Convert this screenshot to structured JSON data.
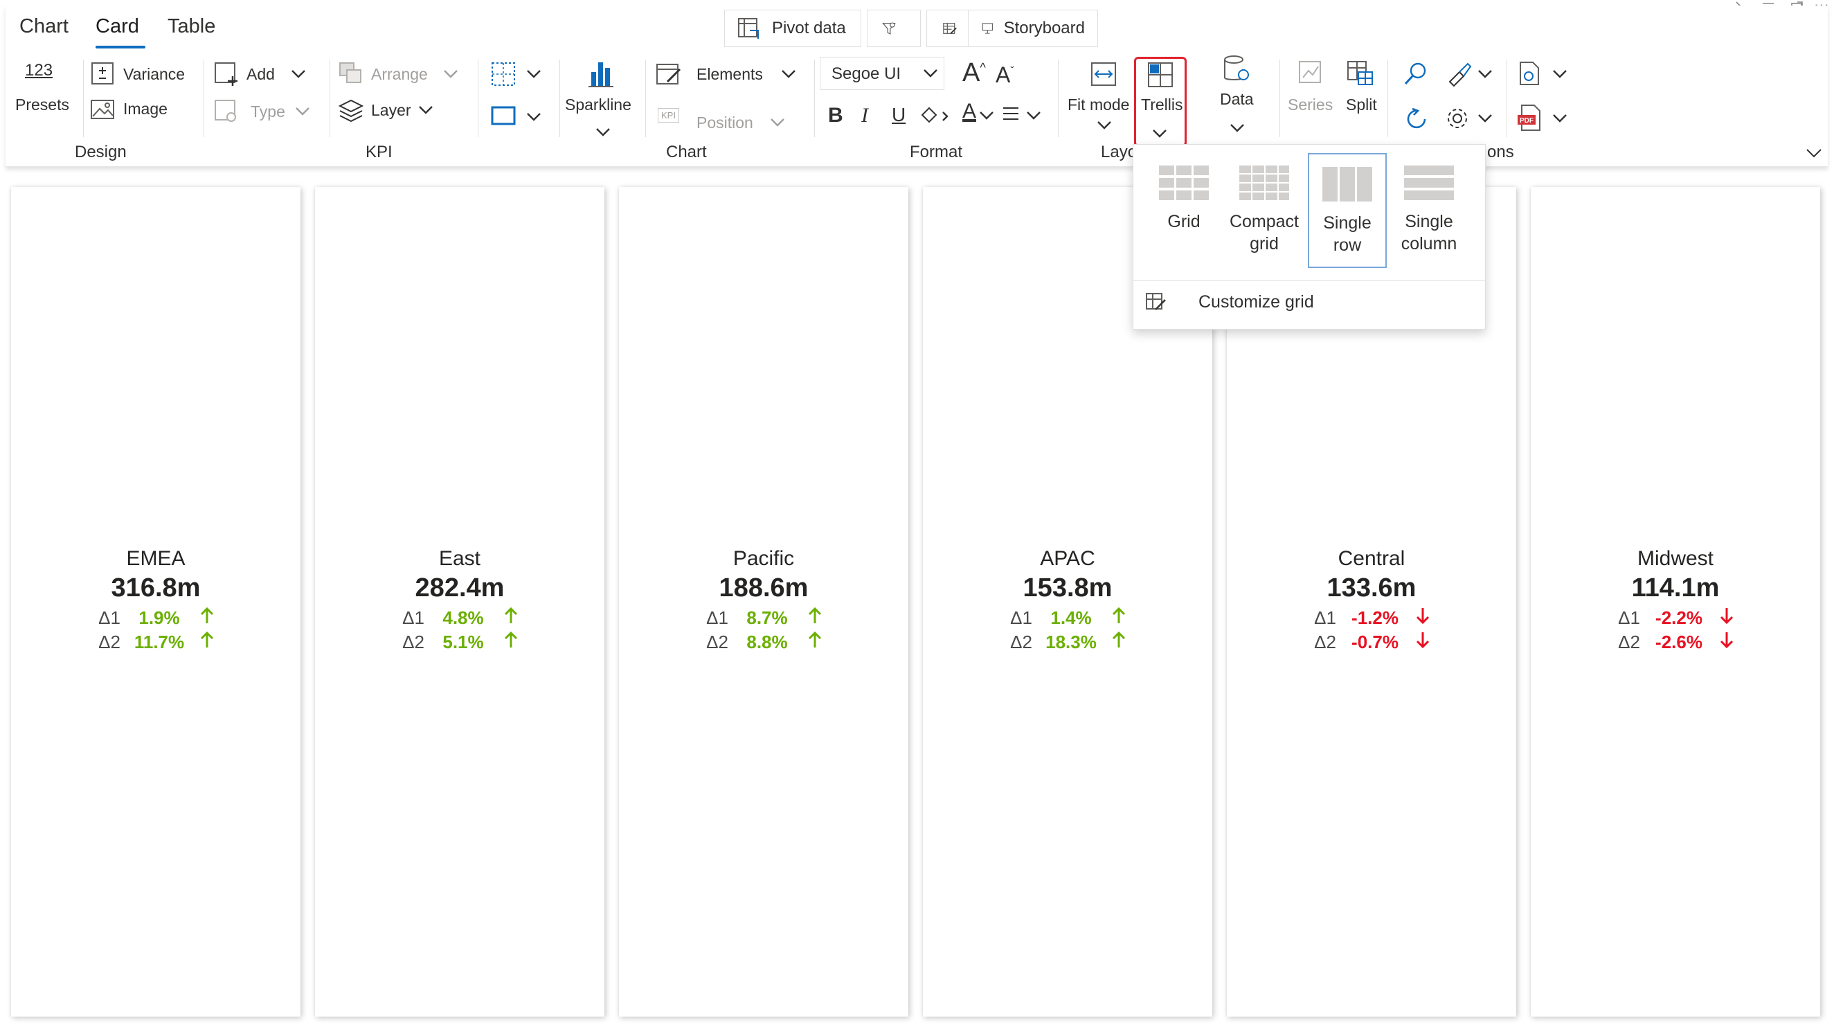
{
  "tabs": [
    {
      "label": "Chart",
      "active": false
    },
    {
      "label": "Card",
      "active": true
    },
    {
      "label": "Table",
      "active": false
    }
  ],
  "top_buttons": {
    "pivot_data": "Pivot data",
    "storyboard": "Storyboard"
  },
  "ribbon": {
    "design": {
      "presets_number": "123",
      "presets_label": "Presets",
      "variance": "Variance",
      "image": "Image",
      "group": "Design"
    },
    "kpi": {
      "add": "Add",
      "type": "Type",
      "arrange": "Arrange",
      "layer": "Layer",
      "group": "KPI"
    },
    "chart": {
      "sparkline": "Sparkline",
      "elements": "Elements",
      "position": "Position",
      "kpi_badge": "KPI",
      "group": "Chart"
    },
    "format": {
      "font": "Segoe UI",
      "bold": "B",
      "italic": "I",
      "underline": "U",
      "font_color_letter": "A",
      "group": "Format"
    },
    "layout": {
      "fit_mode": "Fit mode",
      "trellis": "Trellis",
      "group": "Layo"
    },
    "data": {
      "label": "Data"
    },
    "series": {
      "series": "Series",
      "split": "Split"
    },
    "options_group": "ons"
  },
  "trellis_menu": {
    "options": [
      {
        "label_line1": "Grid",
        "label_line2": "",
        "selected": false
      },
      {
        "label_line1": "Compact",
        "label_line2": "grid",
        "selected": false
      },
      {
        "label_line1": "Single",
        "label_line2": "row",
        "selected": true
      },
      {
        "label_line1": "Single",
        "label_line2": "column",
        "selected": false
      }
    ],
    "customize": "Customize grid"
  },
  "cards": [
    {
      "name": "EMEA",
      "value": "316.8m",
      "d1_label": "Δ1",
      "d1": "1.9%",
      "d1_dir": "up",
      "d2_label": "Δ2",
      "d2": "11.7%",
      "d2_dir": "up"
    },
    {
      "name": "East",
      "value": "282.4m",
      "d1_label": "Δ1",
      "d1": "4.8%",
      "d1_dir": "up",
      "d2_label": "Δ2",
      "d2": "5.1%",
      "d2_dir": "up"
    },
    {
      "name": "Pacific",
      "value": "188.6m",
      "d1_label": "Δ1",
      "d1": "8.7%",
      "d1_dir": "up",
      "d2_label": "Δ2",
      "d2": "8.8%",
      "d2_dir": "up"
    },
    {
      "name": "APAC",
      "value": "153.8m",
      "d1_label": "Δ1",
      "d1": "1.4%",
      "d1_dir": "up",
      "d2_label": "Δ2",
      "d2": "18.3%",
      "d2_dir": "up"
    },
    {
      "name": "Central",
      "value": "133.6m",
      "d1_label": "Δ1",
      "d1": "-1.2%",
      "d1_dir": "down",
      "d2_label": "Δ2",
      "d2": "-0.7%",
      "d2_dir": "down"
    },
    {
      "name": "Midwest",
      "value": "114.1m",
      "d1_label": "Δ1",
      "d1": "-2.2%",
      "d1_dir": "down",
      "d2_label": "Δ2",
      "d2": "-2.6%",
      "d2_dir": "down"
    }
  ],
  "colors": {
    "positive": "#6bb000",
    "negative": "#e81123",
    "accent": "#0f6cbd",
    "highlight": "#e0242f"
  }
}
